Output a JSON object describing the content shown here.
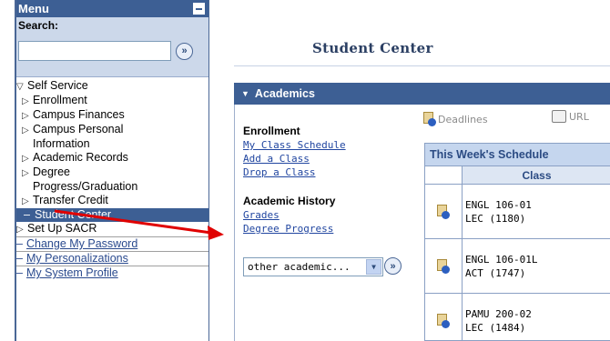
{
  "menu": {
    "title": "Menu",
    "search_label": "Search:",
    "search_value": "",
    "go_symbol": "»",
    "items": [
      {
        "label": "Self Service",
        "expanded": true
      },
      {
        "label": "Enrollment"
      },
      {
        "label": "Campus Finances"
      },
      {
        "label": "Campus Personal"
      },
      {
        "label": "Information"
      },
      {
        "label": "Academic Records"
      },
      {
        "label": "Degree"
      },
      {
        "label": "Progress/Graduation"
      },
      {
        "label": "Transfer Credit"
      },
      {
        "label": "Student Center"
      },
      {
        "label": "Set Up SACR"
      },
      {
        "label": "Change My Password"
      },
      {
        "label": "My Personalizations"
      },
      {
        "label": "My System Profile"
      }
    ]
  },
  "main": {
    "title": "Student Center",
    "section_title": "Academics",
    "deadlines_label": "Deadlines",
    "url_label": "URL",
    "enrollment_label": "Enrollment",
    "enrollment_links": [
      "My Class Schedule",
      "Add a Class",
      "Drop a Class"
    ],
    "history_label": "Academic History",
    "history_links": [
      "Grades",
      "Degree Progress"
    ],
    "other_select_value": "other academic...",
    "schedule": {
      "heading": "This Week's Schedule",
      "col_class": "Class",
      "rows": [
        {
          "line1": "ENGL 106-01",
          "line2": "LEC (1180)"
        },
        {
          "line1": "ENGL 106-01L",
          "line2": "ACT (1747)"
        },
        {
          "line1": "PAMU 200-02",
          "line2": "LEC (1484)"
        }
      ]
    }
  },
  "colors": {
    "header_blue": "#3d5f94",
    "search_bg": "#ccd8ea",
    "link_blue": "#2146a0",
    "arrow_red": "#e00000"
  },
  "icons": [
    "minimize-icon",
    "go-arrow-icon",
    "expand-triangle-icon",
    "deadlines-icon",
    "url-icon",
    "calendar-icon"
  ]
}
